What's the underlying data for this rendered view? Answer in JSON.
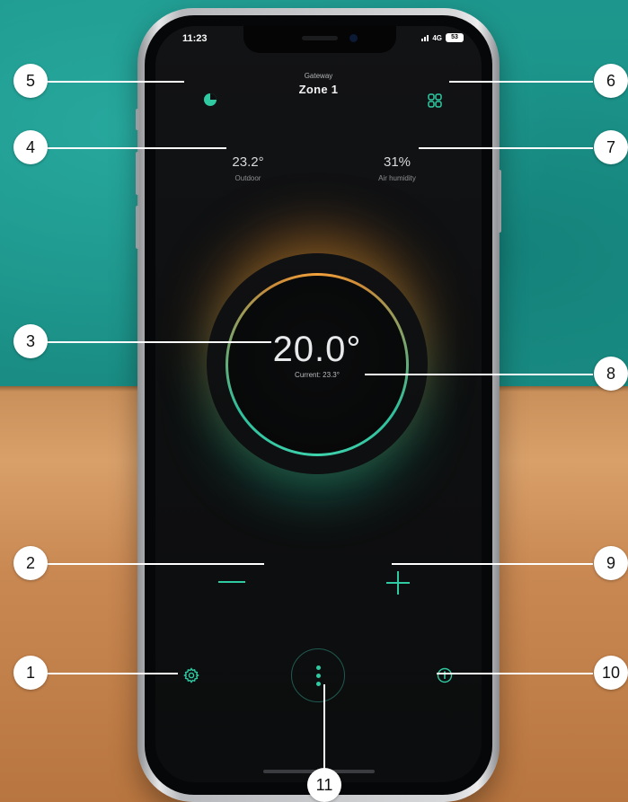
{
  "status_bar": {
    "time": "11:23",
    "network": "4G",
    "battery": "53"
  },
  "header": {
    "subtitle": "Gateway",
    "title": "Zone 1"
  },
  "outdoor": {
    "value": "23.2°",
    "label": "Outdoor"
  },
  "humidity": {
    "value": "31%",
    "label": "Air humidity"
  },
  "thermostat": {
    "setpoint": "20.0°",
    "current": "Current: 23.3°"
  },
  "callouts": [
    "1",
    "2",
    "3",
    "4",
    "5",
    "6",
    "7",
    "8",
    "9",
    "10",
    "11"
  ],
  "icons": {
    "schedule": "clock-icon",
    "zones": "grid-icon",
    "decrease": "minus-icon",
    "increase": "plus-icon",
    "settings": "gear-icon",
    "info": "info-icon",
    "menu": "more-vertical-icon"
  },
  "colors": {
    "accent": "#2fc9a2",
    "warm_glow": "#f2a23c",
    "background": "#0e0f10"
  }
}
